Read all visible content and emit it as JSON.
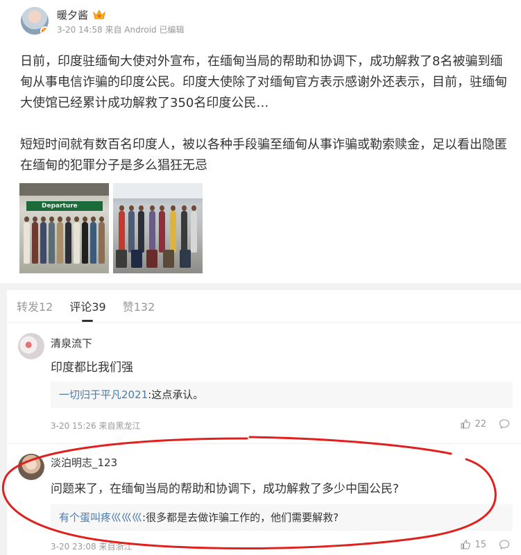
{
  "post": {
    "author": "暖夕酱",
    "meta": "3-20 14:58 来自 Android 已编辑",
    "paragraph1": "日前，印度驻缅甸大使对外宣布，在缅甸当局的帮助和协调下，成功解救了8名被骗到缅甸从事电信诈骗的印度公民。印度大使除了对缅甸官方表示感谢外还表示，目前，驻缅甸大使馆已经累计成功解救了350名印度公民…",
    "paragraph2": "短短时间就有数百名印度人，被以各种手段骗至缅甸从事诈骗或勒索赎金，足以看出隐匿在缅甸的犯罪分子是多么猖狂无忌",
    "photo1_sign": "Departure"
  },
  "tabs": {
    "repost": "转发12",
    "comment": "评论39",
    "like": "赞132"
  },
  "comments": [
    {
      "user": "清泉流下",
      "text": "印度都比我们强",
      "reply_user": "一切归于平凡2021",
      "reply_text": ":这点承认。",
      "meta": "3-20 15:26 来自黑龙江",
      "likes": "22"
    },
    {
      "user": "淡泊明志_123",
      "text": "问题来了，在缅甸当局的帮助和协调下，成功解救了多少中国公民?",
      "reply_user": "有个蛋叫疼巛巛巛",
      "reply_text": ":很多都是去做诈骗工作的，他们需要解救?",
      "meta": "3-20 23:08 来自浙江",
      "likes": "15"
    }
  ],
  "colors": {
    "link": "#4d79aa",
    "annotation": "#e0201c",
    "vip": "#ff8200"
  }
}
